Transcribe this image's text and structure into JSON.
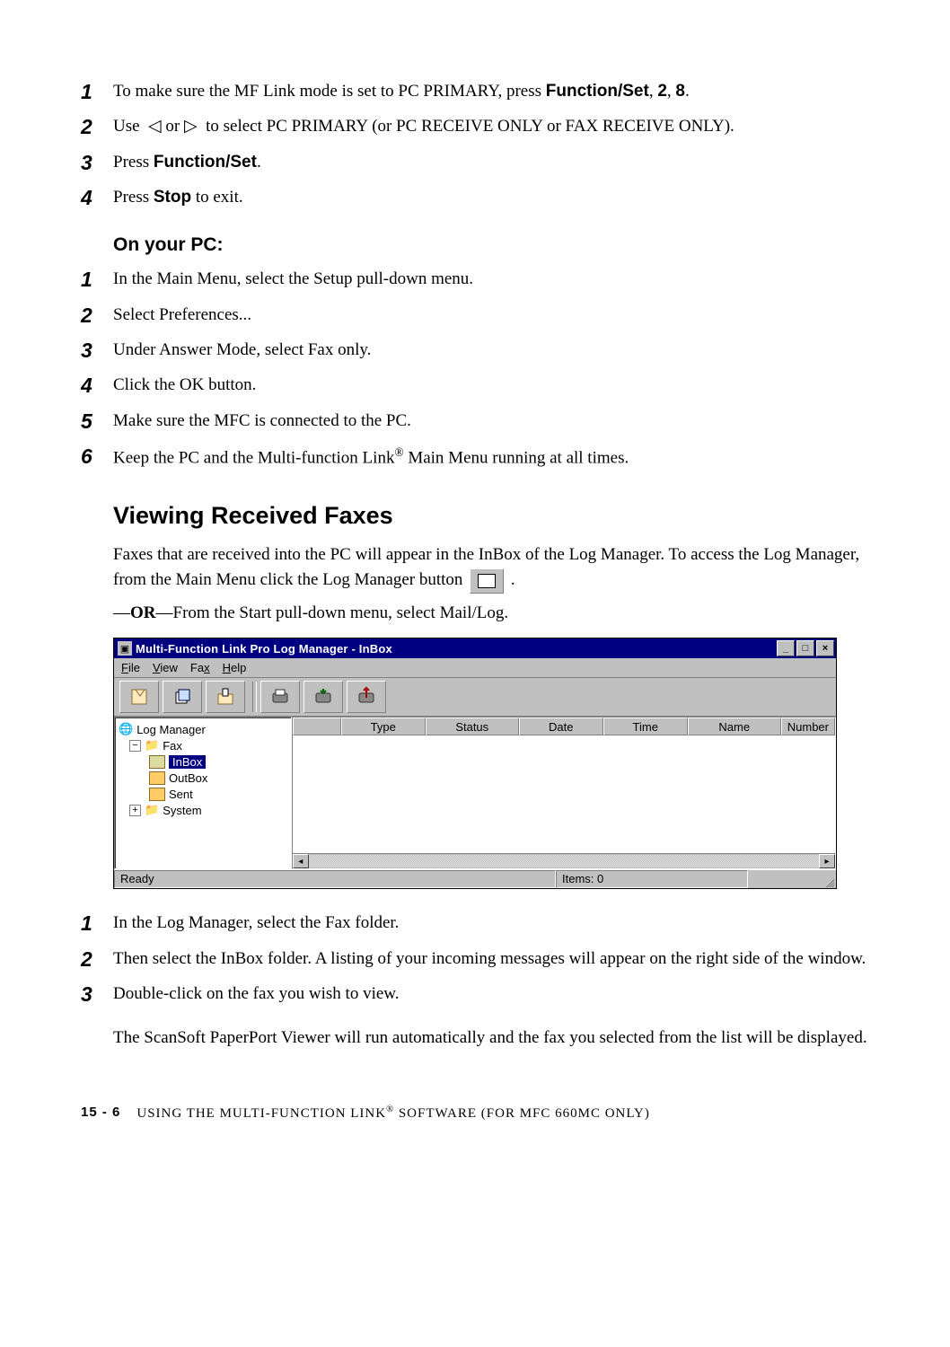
{
  "stepsA": [
    {
      "n": "1",
      "pre": "To make sure the MF Link mode is set to PC PRIMARY, press ",
      "b1": "Function/Set",
      "mid": ", ",
      "b2": "2",
      "mid2": ", ",
      "b3": "8",
      "post": "."
    },
    {
      "n": "2",
      "text": "Use  ◁ or ▷  to select PC PRIMARY (or PC RECEIVE ONLY or FAX RECEIVE ONLY)."
    },
    {
      "n": "3",
      "pre": "Press ",
      "b1": "Function/Set",
      "post": "."
    },
    {
      "n": "4",
      "pre": "Press ",
      "b1": "Stop",
      "post": " to exit."
    }
  ],
  "onYourPC": "On your PC:",
  "stepsB": [
    {
      "n": "1",
      "text": "In the Main Menu, select the Setup pull-down menu."
    },
    {
      "n": "2",
      "text": "Select Preferences..."
    },
    {
      "n": "3",
      "text": "Under Answer Mode, select Fax only."
    },
    {
      "n": "4",
      "text": "Click the OK button."
    },
    {
      "n": "5",
      "text": "Make sure the MFC is connected to the PC."
    },
    {
      "n": "6",
      "html": "Keep the PC and the Multi-function Link<sup>®</sup> Main Menu running at all times."
    }
  ],
  "sectionHeading": "Viewing Received Faxes",
  "para1": "Faxes that are received into the PC will appear in the InBox of the Log Manager.  To access the Log Manager, from the Main Menu click the Log Manager button ",
  "para1_post": ".",
  "orLine_pre": "—",
  "orLine_b": "OR",
  "orLine_post": "—From the Start pull-down menu, select  Mail/Log.",
  "window": {
    "title": "Multi-Function Link Pro Log Manager - InBox",
    "menus": [
      "File",
      "View",
      "Fax",
      "Help"
    ],
    "tree": {
      "root": "Log Manager",
      "fax": "Fax",
      "inbox": "InBox",
      "outbox": "OutBox",
      "sent": "Sent",
      "system": "System"
    },
    "columns": [
      "",
      "Type",
      "Status",
      "Date",
      "Time",
      "Name",
      "Number"
    ],
    "statusReady": "Ready",
    "statusItems": "Items: 0"
  },
  "stepsC": [
    {
      "n": "1",
      "text": "In the Log Manager, select the Fax folder."
    },
    {
      "n": "2",
      "text": "Then select the InBox folder.  A listing of your incoming messages will appear on the right side of the window."
    },
    {
      "n": "3",
      "text": "Double-click on the fax you wish to view."
    }
  ],
  "afterPara": "The ScanSoft PaperPort Viewer will run automatically and the fax you selected from the list will be displayed.",
  "footer": {
    "page": "15 - 6",
    "text": "USING THE MULTI-FUNCTION LINK",
    "sup": "®",
    "text2": " SOFTWARE (FOR MFC 660MC ONLY)"
  }
}
